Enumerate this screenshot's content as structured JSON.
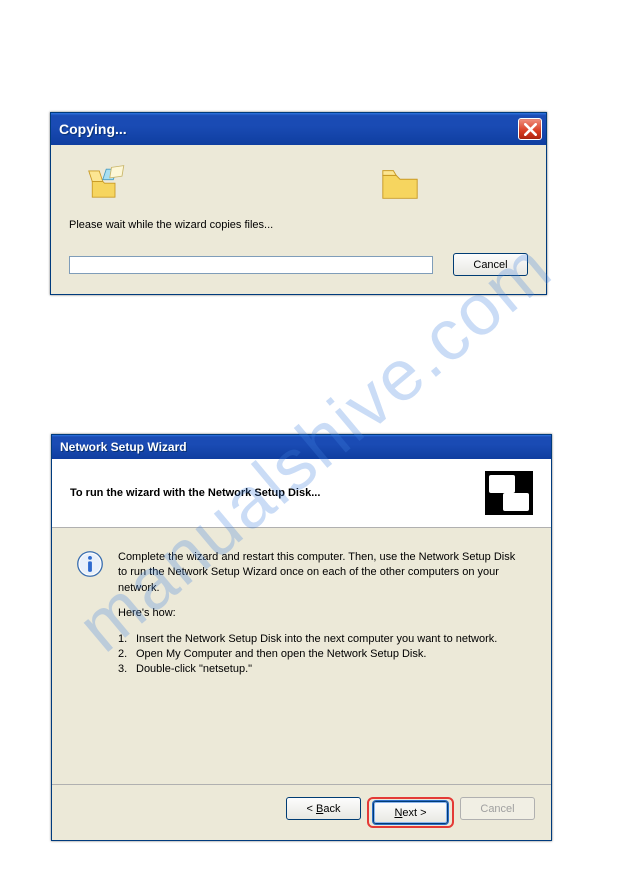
{
  "watermark": "manualshive.com",
  "copying": {
    "title": "Copying...",
    "message": "Please wait while the wizard copies files...",
    "cancel_label": "Cancel"
  },
  "wizard": {
    "title": "Network Setup Wizard",
    "header_prefix": "To run the wizard with the ",
    "header_bold": "Network Setup Disk",
    "header_suffix": "...",
    "body_para": "Complete the wizard and restart this computer. Then, use the Network Setup Disk to run the Network Setup Wizard once on each of the other computers on your network.",
    "heres_how": "Here's how:",
    "steps": [
      "Insert the Network Setup Disk into the next computer you want to network.",
      "Open My Computer and then open the Network Setup Disk.",
      "Double-click \"netsetup.\""
    ],
    "back_prefix": "< ",
    "back_u": "B",
    "back_rest": "ack",
    "next_u": "N",
    "next_rest": "ext >",
    "cancel_label": "Cancel"
  }
}
